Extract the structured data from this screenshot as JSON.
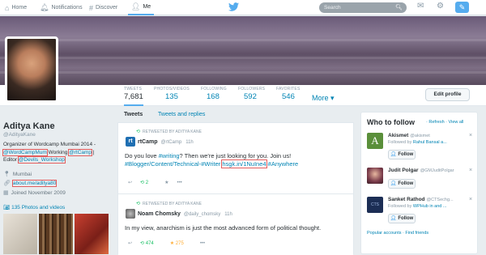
{
  "nav": {
    "home": "Home",
    "notifications": "Notifications",
    "discover": "Discover",
    "me": "Me",
    "search_placeholder": "Search"
  },
  "stats": [
    {
      "label": "TWEETS",
      "value": "7,681"
    },
    {
      "label": "PHOTOS/VIDEOS",
      "value": "135"
    },
    {
      "label": "FOLLOWING",
      "value": "168"
    },
    {
      "label": "FOLLOWERS",
      "value": "592"
    },
    {
      "label": "FAVORITES",
      "value": "546"
    }
  ],
  "more_label": "More",
  "edit_profile_label": "Edit profile",
  "profile": {
    "name": "Aditya Kane",
    "handle": "@AdityaKane",
    "bio_line1": "Organizer of Wordcamp Mumbai 2014 -",
    "bio_link1": "@WordCampMum",
    "bio_mid1": " Working ",
    "bio_link2": "@rtCamp",
    "bio_mid2": " | Editor ",
    "bio_link3": "@Devils_Workshop",
    "location": "Mumbai",
    "url": "about.me/aditya80",
    "joined": "Joined November 2009",
    "photos_link": "135 Photos and videos"
  },
  "tabs": {
    "tweets": "Tweets",
    "tweets_replies": "Tweets and replies"
  },
  "tweets": [
    {
      "retweeted_by": "RETWEETED BY ADITYA KANE",
      "name": "rtCamp",
      "screen_name": "@rtCamp",
      "time": "11h",
      "text_a": "Do you love ",
      "hash_writing": "#writing",
      "text_b": "? Then we're just looking for you. Join us!",
      "hash_line": "#Blogger/Content/Technical-",
      "hash_writer": "#Writer",
      "link": "hsgk.in/1NuIne4",
      "hash_anywhere": "#Anywhere",
      "retweets": "2",
      "favorites": ""
    },
    {
      "retweeted_by": "RETWEETED BY ADITYA KANE",
      "name": "Noam Chomsky",
      "screen_name": "@daily_chomsky",
      "time": "11h",
      "text": "In my view, anarchism is just the most advanced form of political thought.",
      "retweets": "474",
      "favorites": "275"
    }
  ],
  "who_to_follow": {
    "title": "Who to follow",
    "refresh": "Refresh",
    "view_all": "View all",
    "follow_label": "Follow",
    "suggestions": [
      {
        "name": "Akismet",
        "screen_name": "@akismet",
        "sub": "Followed by ",
        "sub_link": "Rahul Bansal a..."
      },
      {
        "name": "Judit Polgar",
        "screen_name": "@GMJuditPolgar",
        "sub": "",
        "sub_link": ""
      },
      {
        "name": "Sanket Rathod",
        "screen_name": "@CTSechg...",
        "sub": "Followed by ",
        "sub_link": "WPHub in and ..."
      }
    ],
    "footer_a": "Popular accounts",
    "footer_b": "Find friends"
  },
  "colors": {
    "accent": "#55acee",
    "link": "#0084b4",
    "retweet": "#17bf63",
    "favorite": "#ffac33"
  }
}
